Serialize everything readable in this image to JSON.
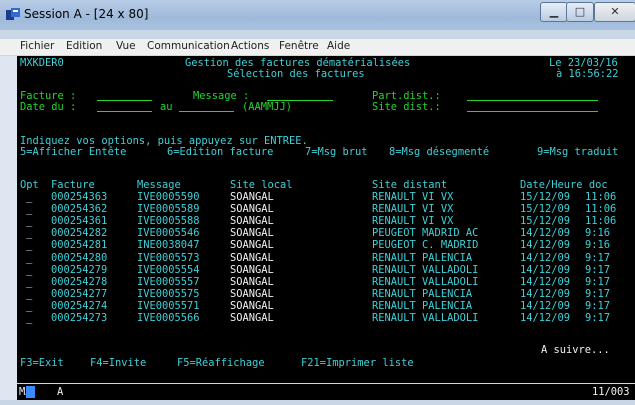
{
  "window": {
    "title": "Session A - [24 x 80]"
  },
  "menu": [
    "Fichier",
    "Edition",
    "Vue",
    "Communication",
    "Actions",
    "Fenêtre",
    "Aide"
  ],
  "header": {
    "program": "MXKDER0",
    "title1": "Gestion des factures dématérialisées",
    "title2": "Sélection des factures",
    "date": "Le 23/03/16",
    "time": "à 16:56:22"
  },
  "filters": {
    "facture_label": "Facture :",
    "message_label": "Message :",
    "partdist_label": "Part.dist.:",
    "date_label": "Date du :",
    "au_label": "au",
    "format_hint": "(AAMMJJ)",
    "sitedist_label": "Site dist.:"
  },
  "instructions": {
    "line1": "Indiquez vos options, puis appuyez sur ENTREE.",
    "options": [
      "5=Afficher Entête",
      "6=Edition facture",
      "7=Msg brut",
      "8=Msg désegmenté",
      "9=Msg traduit"
    ]
  },
  "columns": [
    "Opt",
    "Facture",
    "Message",
    "Site local",
    "Site distant",
    "Date/Heure doc"
  ],
  "rows": [
    {
      "opt": "_",
      "facture": "000254363",
      "message": "IVE0005590",
      "local": "SOANGAL",
      "distant": "RENAULT VI VX",
      "date": "15/12/09",
      "time": "11:06"
    },
    {
      "opt": "_",
      "facture": "000254362",
      "message": "IVE0005589",
      "local": "SOANGAL",
      "distant": "RENAULT VI VX",
      "date": "15/12/09",
      "time": "11:06"
    },
    {
      "opt": "_",
      "facture": "000254361",
      "message": "IVE0005588",
      "local": "SOANGAL",
      "distant": "RENAULT VI VX",
      "date": "15/12/09",
      "time": "11:06"
    },
    {
      "opt": "_",
      "facture": "000254282",
      "message": "IVE0005546",
      "local": "SOANGAL",
      "distant": "PEUGEOT MADRID AC",
      "date": "14/12/09",
      "time": "9:16"
    },
    {
      "opt": "_",
      "facture": "000254281",
      "message": "INE0038047",
      "local": "SOANGAL",
      "distant": "PEUGEOT C. MADRID",
      "date": "14/12/09",
      "time": "9:16"
    },
    {
      "opt": "_",
      "facture": "000254280",
      "message": "IVE0005573",
      "local": "SOANGAL",
      "distant": "RENAULT PALENCIA",
      "date": "14/12/09",
      "time": "9:17"
    },
    {
      "opt": "_",
      "facture": "000254279",
      "message": "IVE0005554",
      "local": "SOANGAL",
      "distant": "RENAULT VALLADOLI",
      "date": "14/12/09",
      "time": "9:17"
    },
    {
      "opt": "_",
      "facture": "000254278",
      "message": "IVE0005557",
      "local": "SOANGAL",
      "distant": "RENAULT VALLADOLI",
      "date": "14/12/09",
      "time": "9:17"
    },
    {
      "opt": "_",
      "facture": "000254277",
      "message": "IVE0005575",
      "local": "SOANGAL",
      "distant": "RENAULT PALENCIA",
      "date": "14/12/09",
      "time": "9:17"
    },
    {
      "opt": "_",
      "facture": "000254274",
      "message": "IVE0005571",
      "local": "SOANGAL",
      "distant": "RENAULT PALENCIA",
      "date": "14/12/09",
      "time": "9:17"
    },
    {
      "opt": "_",
      "facture": "000254273",
      "message": "IVE0005566",
      "local": "SOANGAL",
      "distant": "RENAULT VALLADOLI",
      "date": "14/12/09",
      "time": "9:17"
    }
  ],
  "more": "A suivre...",
  "fkeys": [
    "F3=Exit",
    "F4=Invite",
    "F5=Réaffichage",
    "F21=Imprimer liste"
  ],
  "status": {
    "left": "MA",
    "mode": "A",
    "position": "11/003"
  },
  "colors": {
    "green": "#23d62d",
    "cyan": "#3fd0d8",
    "white": "#f2f2f2",
    "background": "#000000"
  }
}
